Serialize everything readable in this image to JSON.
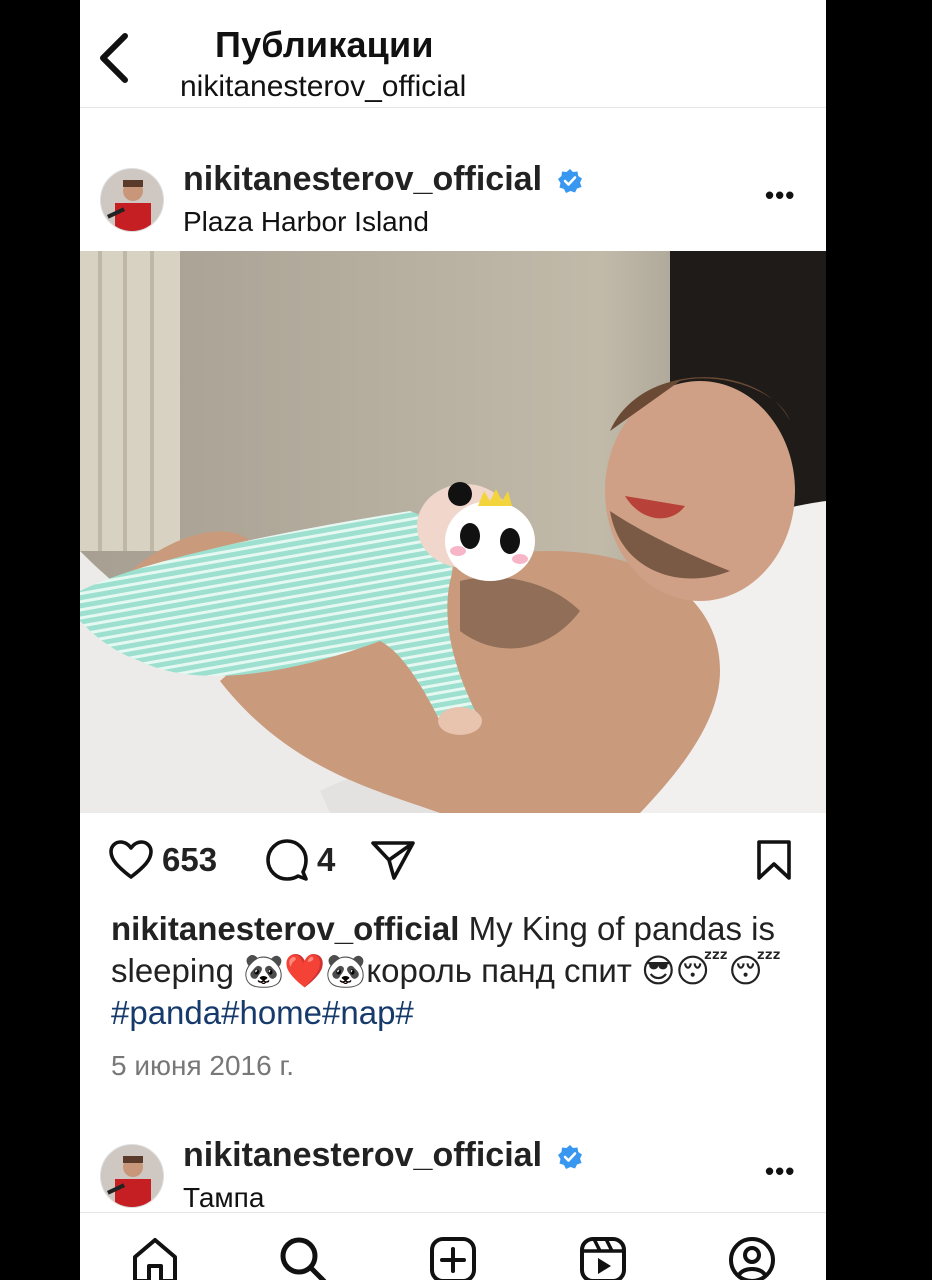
{
  "header": {
    "title": "Публикации",
    "subtitle": "nikitanesterov_official",
    "back_icon": "chevron-left-icon"
  },
  "post": {
    "username": "nikitanesterov_official",
    "verified": true,
    "location": "Plaza Harbor Island",
    "more_label": "•••",
    "likes": "653",
    "comments": "4",
    "caption_user": "nikitanesterov_official",
    "caption_text": " My King of pandas is sleeping 🐼❤️🐼король панд спит 😎😴😴",
    "hashtags": "#panda#home#nap#",
    "date": "5 июня 2016 г."
  },
  "next_post": {
    "username": "nikitanesterov_official",
    "location": "Тампа",
    "more_label": "•••"
  },
  "nav": {
    "items": [
      "home-icon",
      "search-icon",
      "create-icon",
      "reels-icon",
      "profile-icon"
    ]
  },
  "colors": {
    "verified": "#3897f0",
    "hashtag": "#163a6b",
    "date": "#777777"
  }
}
